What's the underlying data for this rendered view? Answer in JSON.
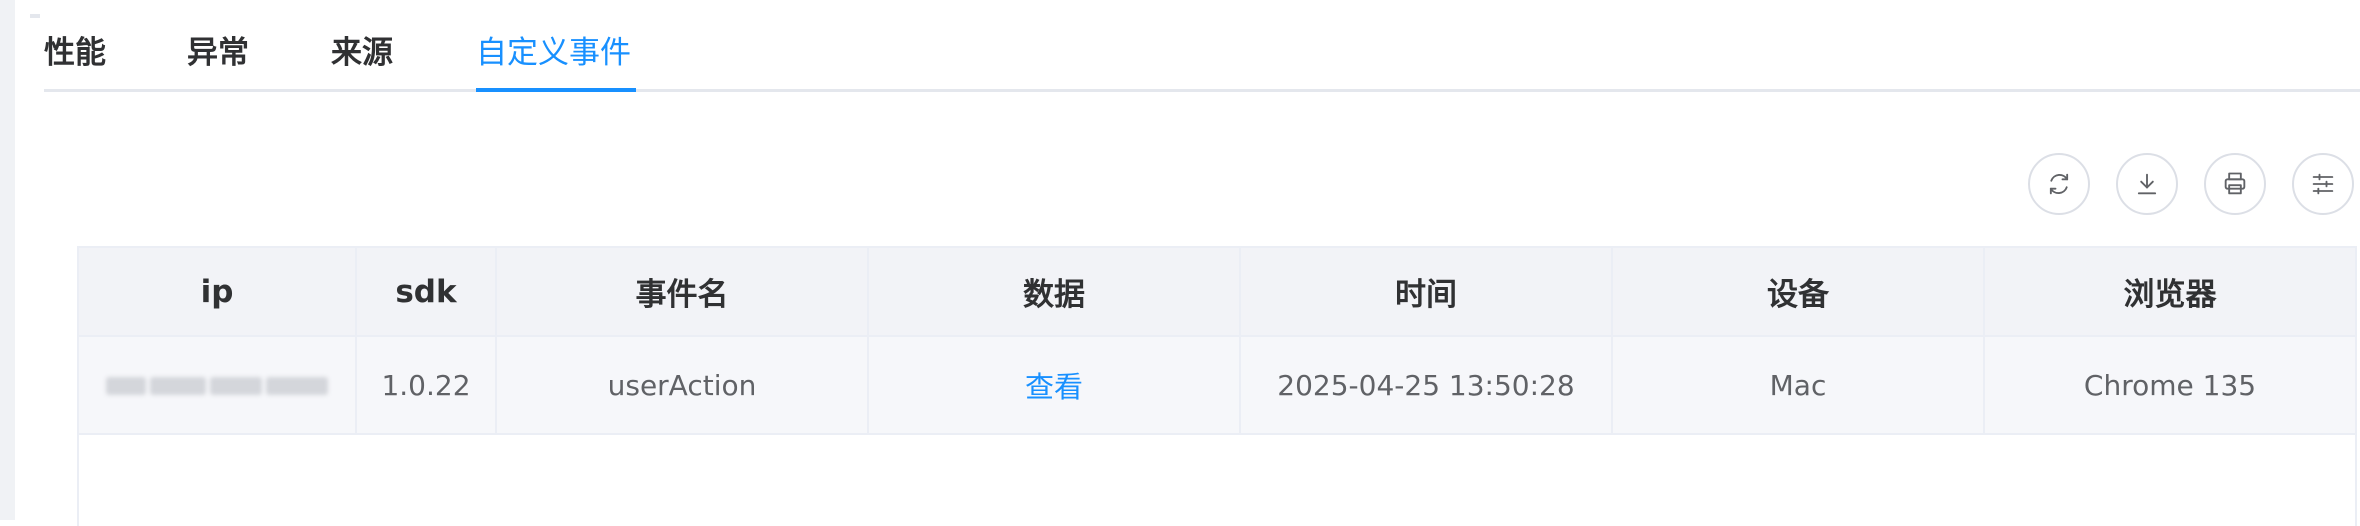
{
  "tabs": [
    {
      "label": "性能"
    },
    {
      "label": "异常"
    },
    {
      "label": "来源"
    },
    {
      "label": "自定义事件",
      "active": true
    }
  ],
  "toolbar": {
    "refresh_icon": "refresh-icon",
    "download_icon": "download-icon",
    "print_icon": "print-icon",
    "settings_icon": "column-settings-icon"
  },
  "table": {
    "columns": [
      "ip",
      "sdk",
      "事件名",
      "数据",
      "时间",
      "设备",
      "浏览器"
    ],
    "rows": [
      {
        "ip": "",
        "sdk": "1.0.22",
        "event_name": "userAction",
        "data_link": "查看",
        "time": "2025-04-25 13:50:28",
        "device": "Mac",
        "browser": "Chrome 135"
      }
    ]
  },
  "colors": {
    "accent": "#1890ff",
    "header_bg": "#f2f3f7",
    "row_bg": "#f6f7fa",
    "border": "#ebeef5"
  }
}
